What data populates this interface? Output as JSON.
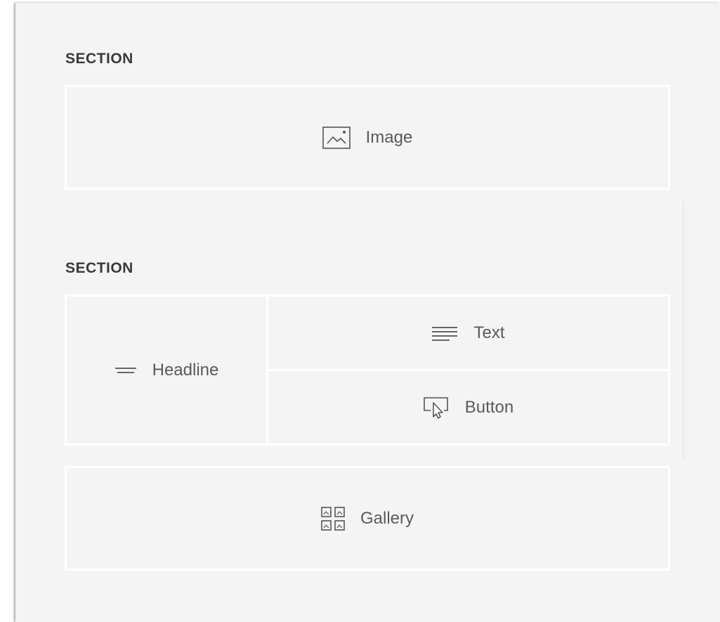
{
  "sections": [
    {
      "label": "SECTION",
      "blocks": [
        {
          "label": "Image",
          "icon": "image-icon"
        }
      ]
    },
    {
      "label": "SECTION",
      "blocks": [
        {
          "label": "Headline",
          "icon": "headline-icon"
        },
        {
          "label": "Text",
          "icon": "text-lines-icon"
        },
        {
          "label": "Button",
          "icon": "button-cursor-icon"
        },
        {
          "label": "Gallery",
          "icon": "gallery-grid-icon"
        }
      ]
    }
  ],
  "colors": {
    "canvas_background": "#f4f4f4",
    "block_border": "#ffffff",
    "label_text": "#5a5a5a",
    "heading_text": "#3a3a3a"
  }
}
